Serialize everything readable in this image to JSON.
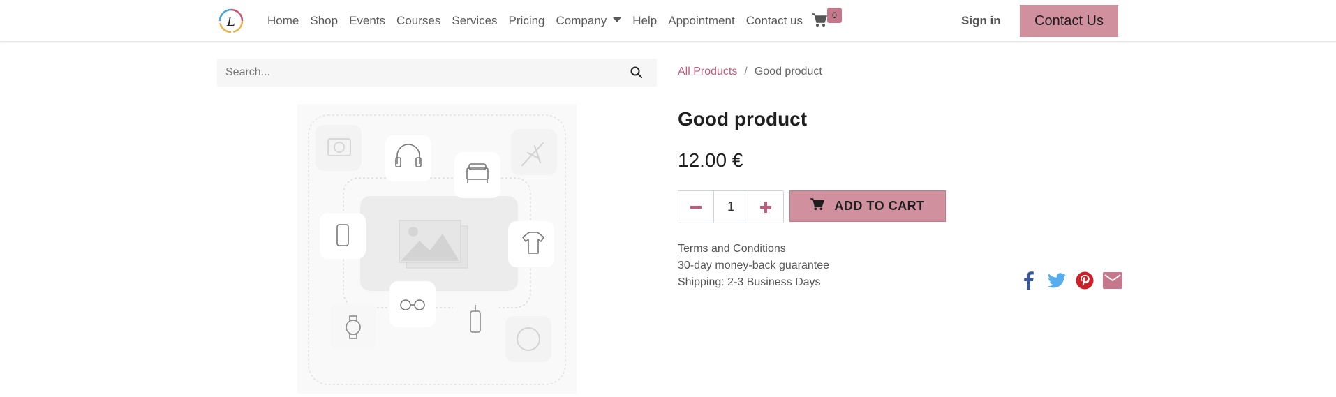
{
  "header": {
    "nav": [
      "Home",
      "Shop",
      "Events",
      "Courses",
      "Services",
      "Pricing",
      "Company",
      "Help",
      "Appointment",
      "Contact us"
    ],
    "cart_count": "0",
    "sign_in": "Sign in",
    "contact_button": "Contact Us"
  },
  "search": {
    "placeholder": "Search..."
  },
  "breadcrumb": {
    "parent": "All Products",
    "current": "Good product"
  },
  "product": {
    "name": "Good product",
    "price": "12.00 €",
    "quantity": "1",
    "add_to_cart": "ADD TO CART",
    "terms_link": "Terms and Conditions",
    "guarantee": "30-day money-back guarantee",
    "shipping": "Shipping: 2-3 Business Days"
  },
  "share": [
    "facebook-icon",
    "twitter-icon",
    "pinterest-icon",
    "email-icon"
  ],
  "colors": {
    "accent": "#d0909e",
    "link": "#c25b7a",
    "facebook": "#3b5998",
    "twitter": "#55acee",
    "pinterest": "#cb2027",
    "email": "#c5788b"
  }
}
